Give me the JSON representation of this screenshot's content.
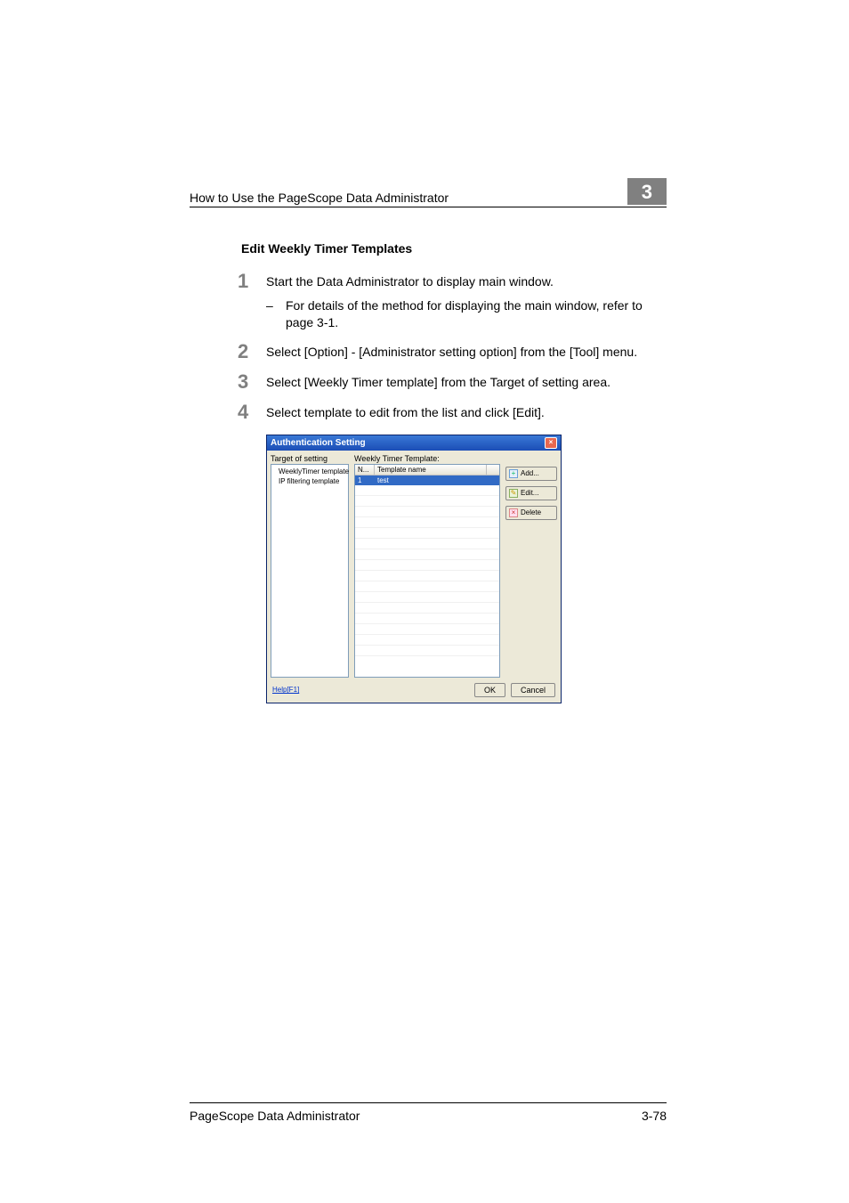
{
  "header": {
    "running_title": "How to Use the PageScope Data Administrator",
    "chapter_badge": "3"
  },
  "subhead": "Edit Weekly Timer Templates",
  "steps": [
    {
      "num": "1",
      "text": "Start the Data Administrator to display main window.",
      "sub_dash": "–",
      "sub_text": "For details of the method for displaying the main window, refer to page 3-1."
    },
    {
      "num": "2",
      "text": "Select [Option] - [Administrator setting option] from the [Tool] menu."
    },
    {
      "num": "3",
      "text": "Select [Weekly Timer template] from the Target of setting area."
    },
    {
      "num": "4",
      "text": "Select template to edit from the list and click [Edit]."
    }
  ],
  "dialog": {
    "title": "Authentication Setting",
    "close_glyph": "×",
    "tree_label": "Target of setting",
    "tree_items": [
      "WeeklyTimer template",
      "IP filtering template"
    ],
    "list_label": "Weekly Timer Template:",
    "th_no": "N...",
    "th_name": "Template name",
    "row_no": "1",
    "row_name": "test",
    "buttons": {
      "add": "Add...",
      "edit": "Edit...",
      "delete": "Delete"
    },
    "help": "Help[F1]",
    "ok": "OK",
    "cancel": "Cancel"
  },
  "footer": {
    "doc_title": "PageScope Data Administrator",
    "page_num": "3-78"
  }
}
